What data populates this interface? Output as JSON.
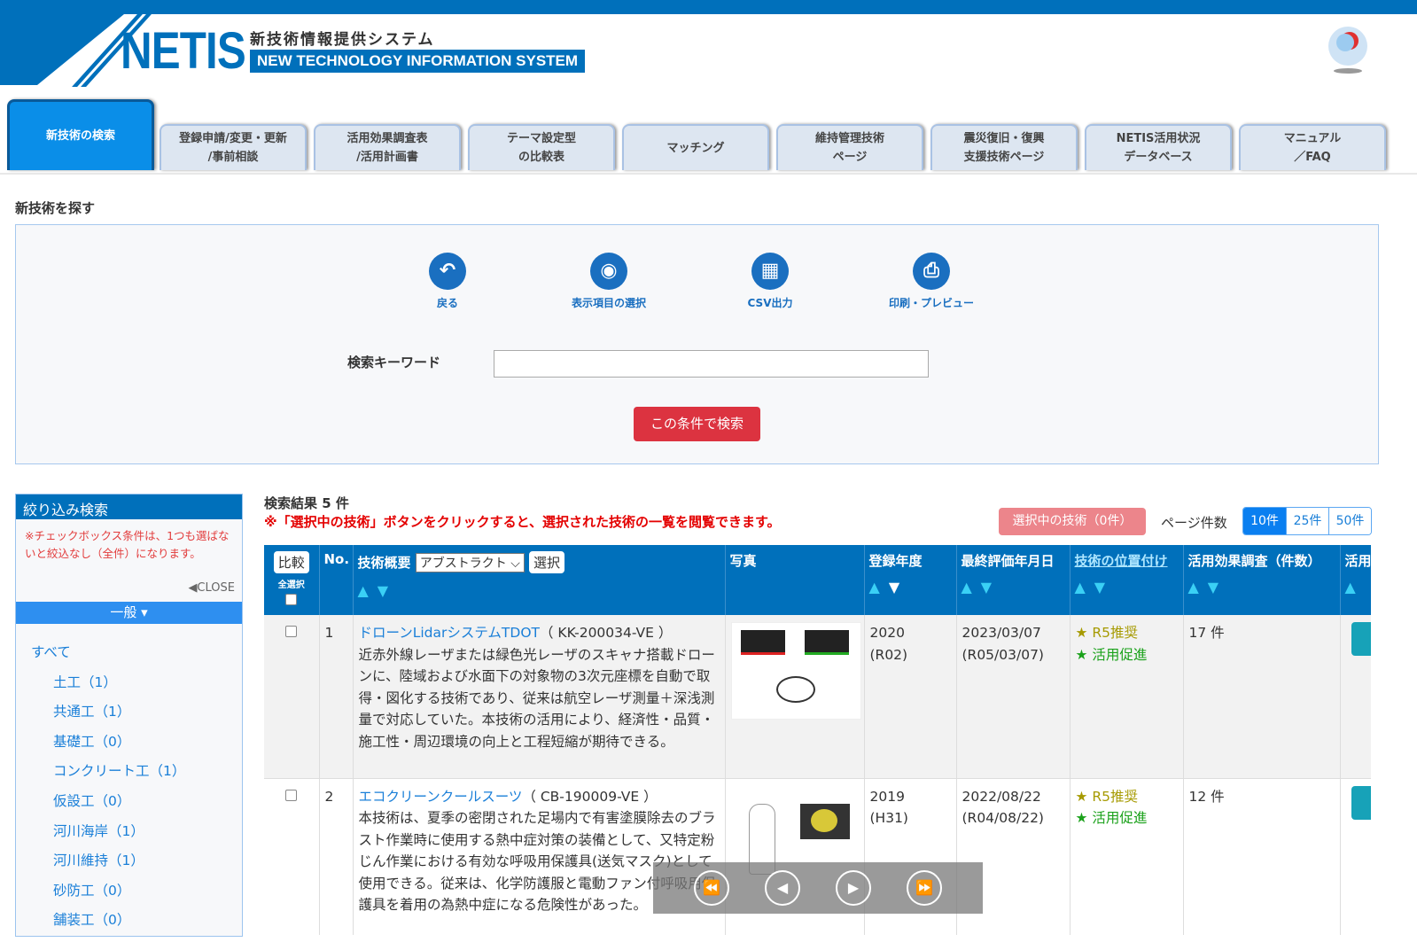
{
  "header": {
    "logo": "NETIS",
    "subtitle_jp": "新技術情報提供システム",
    "subtitle_en": "NEW TECHNOLOGY INFORMATION SYSTEM"
  },
  "tabs": [
    "新技術の検索",
    "登録申請/変更・更新\n/事前相談",
    "活用効果調査表\n/活用計画書",
    "テーマ設定型\nの比較表",
    "マッチング",
    "維持管理技術\nページ",
    "震災復旧・復興\n支援技術ページ",
    "NETIS活用状況\nデータベース",
    "マニュアル\n／FAQ"
  ],
  "search": {
    "title": "新技術を探す",
    "tools": [
      "戻る",
      "表示項目の選択",
      "CSV出力",
      "印刷・プレビュー"
    ],
    "keyword_label": "検索キーワード",
    "keyword_value": "",
    "submit": "この条件で検索"
  },
  "sidebar": {
    "title": "絞り込み検索",
    "note": "※チェックボックス条件は、1つも選ばないと絞込なし（全件）になります。",
    "close": "◀CLOSE",
    "section": "一般 ▾",
    "items": [
      "すべて",
      "土工（1）",
      "共通工（1）",
      "基礎工（0）",
      "コンクリート工（1）",
      "仮設工（0）",
      "河川海岸（1）",
      "河川維持（1）",
      "砂防工（0）",
      "舗装工（0）"
    ]
  },
  "results": {
    "count": "検索結果 5 件",
    "note": "※「選択中の技術」ボタンをクリックすると、選択された技術の一覧を閲覧できます。",
    "selected_btn": "選択中の技術（0件）",
    "page_label": "ページ件数",
    "page_sizes": [
      "10件",
      "25件",
      "50件"
    ],
    "headers": {
      "compare": "比較",
      "select_all": "全選択",
      "no": "No.",
      "summary": "技術概要",
      "summary_select": "アブストラクト ⌵",
      "select_btn": "選択",
      "photo": "写真",
      "year": "登録年度",
      "eval": "最終評価年月日",
      "position": "技術の位置付け",
      "effect": "活用効果調査（件数）",
      "use": "活用"
    },
    "rows": [
      {
        "no": "1",
        "name": "ドローンLidarシステムTDOT",
        "code": "（ KK-200034-VE ）",
        "desc": "近赤外線レーザまたは緑色光レーザのスキャナ搭載ドローンに、陸域および水面下の対象物の3次元座標を自動で取得・図化する技術であり、従来は航空レーザ測量＋深浅測量で対応していた。本技術の活用により、経済性・品質・施工性・周辺環境の向上と工程短縮が期待できる。",
        "year": "2020",
        "year_jp": "(R02)",
        "eval": "2023/03/07",
        "eval_jp": "(R05/03/07)",
        "badge1": "★ R5推奨",
        "badge2": "★ 活用促進",
        "effect": "17 件"
      },
      {
        "no": "2",
        "name": "エコクリーンクールスーツ",
        "code": "（ CB-190009-VE ）",
        "desc": "本技術は、夏季の密閉された足場内で有害塗膜除去のブラスト作業時に使用する熱中症対策の装備として、又特定粉じん作業における有効な呼吸用保護具(送気マスク)として使用できる。従来は、化学防護服と電動ファン付呼吸用保護具を着用の為熱中症になる危険性があった。",
        "year": "2019",
        "year_jp": "(H31)",
        "eval": "2022/08/22",
        "eval_jp": "(R04/08/22)",
        "badge1": "★ R5推奨",
        "badge2": "★ 活用促進",
        "effect": "12 件"
      }
    ]
  },
  "player": [
    "⏪",
    "◀",
    "▶",
    "⏩"
  ]
}
